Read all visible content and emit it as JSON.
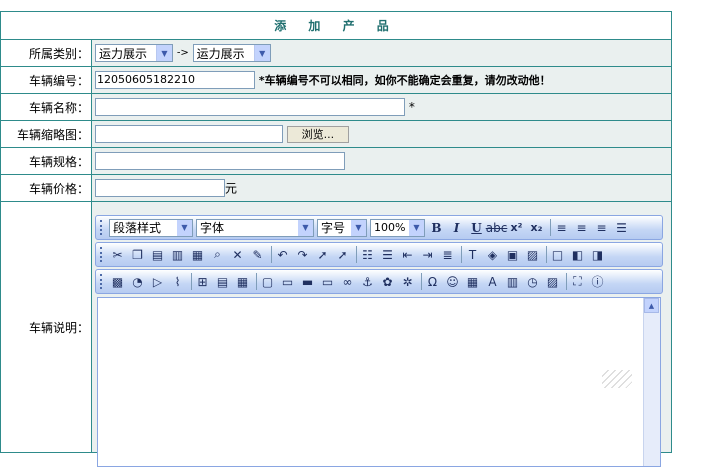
{
  "form": {
    "title": "添 加 产 品",
    "category": {
      "label": "所属类别：",
      "select1": "运力展示",
      "select2": "运力展示",
      "arrow_sep": "->"
    },
    "vehicle_no": {
      "label": "车辆编号：",
      "value": "12050605182210",
      "note": "*车辆编号不可以相同，如你不能确定会重复，请勿改动他！"
    },
    "vehicle_name": {
      "label": "车辆名称：",
      "value": "",
      "required": "*"
    },
    "thumbnail": {
      "label": "车辆缩略图：",
      "value": "",
      "browse": "浏览..."
    },
    "spec": {
      "label": "车辆规格：",
      "value": ""
    },
    "price": {
      "label": "车辆价格：",
      "value": "",
      "unit": "元"
    },
    "description": {
      "label": "车辆说明："
    }
  },
  "editor": {
    "paragraph_style": "段落样式",
    "font": "字体",
    "font_size": "字号",
    "zoom": "100%",
    "toolbar1_icons": [
      "bold-icon",
      "italic-icon",
      "underline-icon",
      "strikethrough-icon",
      "superscript-icon",
      "subscript-icon",
      "align-left-icon",
      "align-center-icon",
      "align-right-icon",
      "justify-icon"
    ],
    "toolbar2_icons": [
      "cut-icon",
      "copy-icon",
      "paste-icon",
      "paste-text-icon",
      "paste-word-icon",
      "find-icon",
      "delete-icon",
      "clean-icon",
      "undo-icon",
      "redo-icon",
      "select-icon",
      "select-all-icon",
      "ordered-list-icon",
      "unordered-list-icon",
      "outdent-icon",
      "indent-icon",
      "block-icon",
      "font-color-icon",
      "bg-color-icon",
      "table-icon",
      "image-icon",
      "flash-icon",
      "layer-icon"
    ],
    "toolbar3_icons": [
      "insert-image-icon",
      "insert-flash-icon",
      "insert-media-icon",
      "attachment-icon",
      "insert-table-icon",
      "insert-row-icon",
      "grid-icon",
      "frame-icon",
      "hr-icon",
      "marquee-icon",
      "form-icon",
      "link-icon",
      "anchor-icon",
      "map-icon",
      "unlink-icon",
      "special-char-icon",
      "emoticon-icon",
      "excel-icon",
      "font-icon",
      "date-icon",
      "time-icon",
      "preview-icon",
      "fullscreen-icon",
      "about-icon"
    ],
    "glyphs": {
      "bold": "B",
      "italic": "I",
      "underline": "U",
      "strike": "abc",
      "sup": "x²",
      "sub": "x₂"
    }
  }
}
